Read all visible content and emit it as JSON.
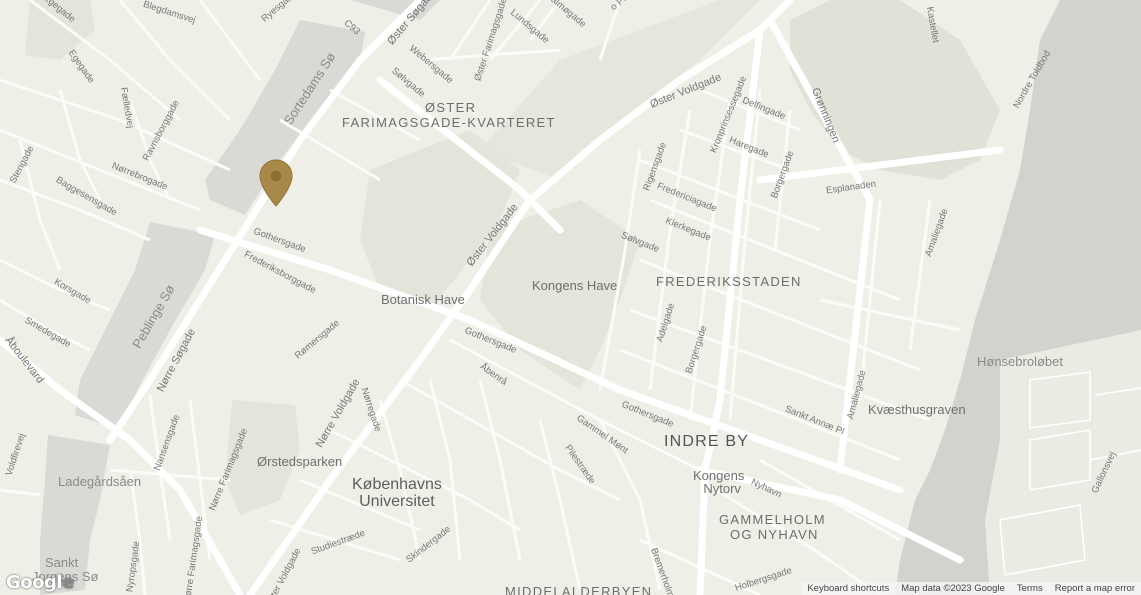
{
  "colors": {
    "land": "#f0efe7",
    "block": "#e9e8df",
    "park": "#e5e4da",
    "road": "#ffffff",
    "lake": "#d9d9d6",
    "sea": "#d2d2cf",
    "pin": "#a8894a"
  },
  "marker": {
    "icon": "map-pin-icon"
  },
  "labels": {
    "streets": {
      "egegade": "Egegade",
      "blegdamsvej": "Blegdamsvej",
      "ryesgade": "Ryesgade",
      "faelledvej": "Fælledvej",
      "ravnsborggade": "Ravnsborggade",
      "norrebrogade": "Nørrebrogade",
      "stengade": "Stengade",
      "baggesensgade": "Baggesensgade",
      "korsgade": "Korsgade",
      "smedegade": "Smedegade",
      "aboulevard": "Åboulevard",
      "voldmestervej": "Voldfirevej",
      "nansensgade": "Nansensgade",
      "norre_farimagsgade": "Nørre Farimagsgade",
      "norre_farimagsgade2": "Nørre Farimagsgade",
      "nyropsgade": "Nyropsgade",
      "norre_sogade": "Nørre Søgade",
      "gothersgade_w": "Gothersgade",
      "frederiksborggade": "Frederiksborggade",
      "romersgade": "Rømersgade",
      "norre_voldgade": "Nørre Voldgade",
      "norregade": "Nørregade",
      "vester_voldgade": "Vester Voldgade",
      "studiestraede": "Studiestræde",
      "skindergade": "Skindergade",
      "oster_sogade": "Øster Søgade",
      "c93": "C93",
      "webersgade": "Webersgade",
      "solvgade_n": "Sølvgade",
      "oster_farimagsgade": "Øster Farimagsgade",
      "lundsgade": "Lundsgade",
      "malmogade": "Malmøgade",
      "oster_voldgade_c": "Øster Voldgade",
      "oster_voldgade_n": "Øster Voldgade",
      "gothersgade_c": "Gothersgade",
      "abenra": "Åbenrå",
      "gammel_mont": "Gammel Mønt",
      "pilestraede": "Pilestræde",
      "gothersgade_e": "Gothersgade",
      "bremerholm": "Bremerholm",
      "holbergsgade": "Holbergsgade",
      "nyhavn": "Nyhavn",
      "sankt_annae": "Sankt Annæ Pl",
      "adelgade": "Adelgade",
      "borgergade_s": "Borgergade",
      "solvgade_e": "Sølvgade",
      "klerkegade": "Klerkegade",
      "fredericiagade": "Fredericiagade",
      "rigensgade": "Rigensgade",
      "kronprinsessegade": "Kronprinsessegade",
      "haregade": "Haregade",
      "delfingade": "Delfingade",
      "borgergade_n": "Borgergade",
      "gronningen": "Grønningen",
      "esplanaden": "Esplanaden",
      "amaliegade_n": "Amaliegade",
      "amaliegade_s": "Amaliegade",
      "kastellet": "Kastellet",
      "nordre_toldbod": "Nordre Toldbod",
      "gallonsvej": "Gallonsvej",
      "stock_pl": "o Pl."
    },
    "areas": {
      "oster_farimagsgade_kvarteret_1": "ØSTER",
      "oster_farimagsgade_kvarteret_2": "FARIMAGSGADE-KVARTERET",
      "frederiksstaden": "FREDERIKSSTADEN",
      "indre_by": "INDRE BY",
      "gammelholm_1": "GAMMELHOLM",
      "gammelholm_2": "OG NYHAVN",
      "middelalderbyen": "MIDDELALDERBYEN",
      "botanisk_have": "Botanisk Have",
      "kongens_have": "Kongens Have",
      "orstedsparken": "Ørstedsparken",
      "kobenhavns_universitet_1": "Københavns",
      "kobenhavns_universitet_2": "Universitet",
      "kongens_nytorv_1": "Kongens",
      "kongens_nytorv_2": "Nytorv",
      "kvaesthusgraven": "Kvæsthusgraven",
      "honsebrolobet": "Hønsebroløbet"
    },
    "water": {
      "sortedams_so": "Sortedams Sø",
      "peblinge_so": "Peblinge Sø",
      "ladegardsaen": "Ladegårdsåen",
      "sankt_jorgens_so_1": "Sankt",
      "sankt_jorgens_so_2": "Jorgens Sø"
    }
  },
  "logo": {
    "text_main": "Googl",
    "text_end": "e"
  },
  "footer": {
    "keyboard_shortcuts": "Keyboard shortcuts",
    "map_data": "Map data ©2023 Google",
    "terms": "Terms",
    "report": "Report a map error"
  }
}
